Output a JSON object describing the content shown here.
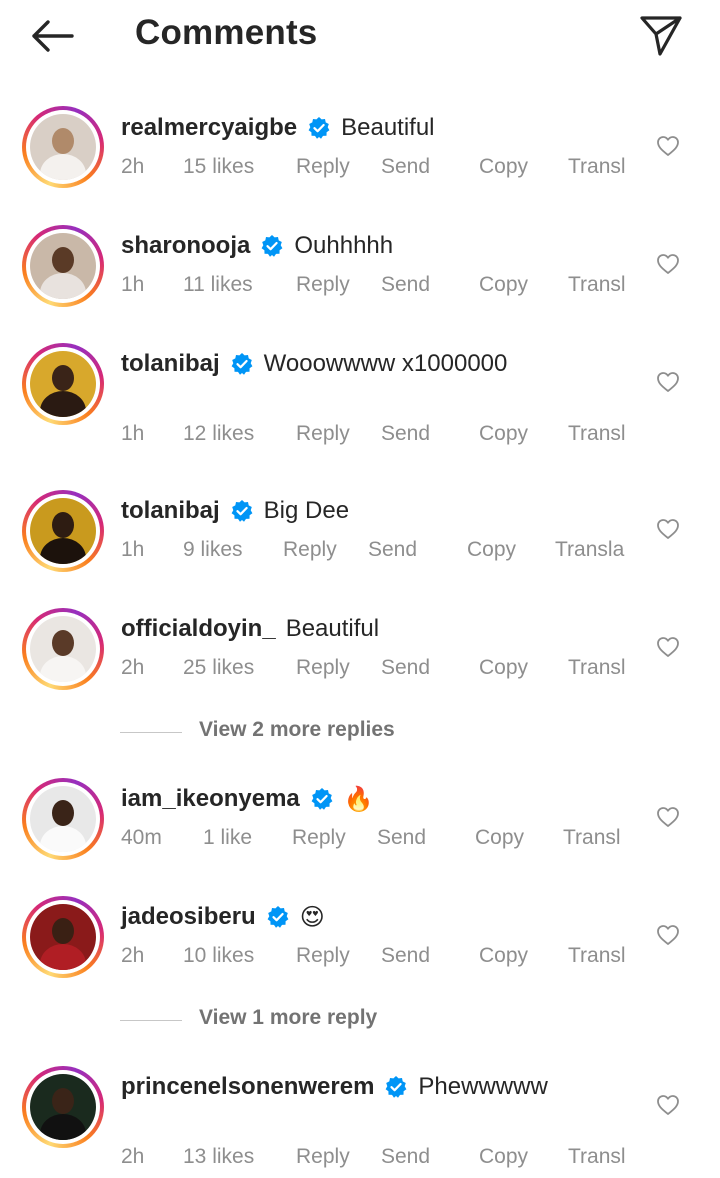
{
  "header": {
    "title": "Comments",
    "back_icon": "arrow-left-icon",
    "send_icon": "paper-plane-icon"
  },
  "colors": {
    "verified": "#0095f6",
    "meta_text": "#8e8e8e",
    "text": "#262626"
  },
  "comments": [
    {
      "username": "realmercyaigbe",
      "verified": true,
      "text": "Beautiful",
      "time": "2h",
      "likes": "15 likes",
      "reply": "Reply",
      "send": "Send",
      "copy": "Copy",
      "translate": "Transl"
    },
    {
      "username": "sharonooja",
      "verified": true,
      "text": "Ouhhhhh",
      "time": "1h",
      "likes": "11 likes",
      "reply": "Reply",
      "send": "Send",
      "copy": "Copy",
      "translate": "Transl"
    },
    {
      "username": "tolanibaj",
      "verified": true,
      "text": "Wooowwww x1000000",
      "time": "1h",
      "likes": "12 likes",
      "reply": "Reply",
      "send": "Send",
      "copy": "Copy",
      "translate": "Transl"
    },
    {
      "username": "tolanibaj",
      "verified": true,
      "text": "Big Dee",
      "time": "1h",
      "likes": "9 likes",
      "reply": "Reply",
      "send": "Send",
      "copy": "Copy",
      "translate": "Transla"
    },
    {
      "username": "officialdoyin_",
      "verified": false,
      "text": "Beautiful",
      "time": "2h",
      "likes": "25 likes",
      "reply": "Reply",
      "send": "Send",
      "copy": "Copy",
      "translate": "Transl"
    },
    {
      "username": "iam_ikeonyema",
      "verified": true,
      "text": "🔥",
      "time": "40m",
      "likes": "1 like",
      "reply": "Reply",
      "send": "Send",
      "copy": "Copy",
      "translate": "Transl"
    },
    {
      "username": "jadeosiberu",
      "verified": true,
      "text": "😍",
      "time": "2h",
      "likes": "10 likes",
      "reply": "Reply",
      "send": "Send",
      "copy": "Copy",
      "translate": "Transl"
    },
    {
      "username": "princenelsonenwerem",
      "verified": true,
      "text": "Phewwwww",
      "time": "2h",
      "likes": "13 likes",
      "reply": "Reply",
      "send": "Send",
      "copy": "Copy",
      "translate": "Transl"
    }
  ],
  "view_more": [
    {
      "label": "View 2 more replies"
    },
    {
      "label": "View 1 more reply"
    }
  ]
}
